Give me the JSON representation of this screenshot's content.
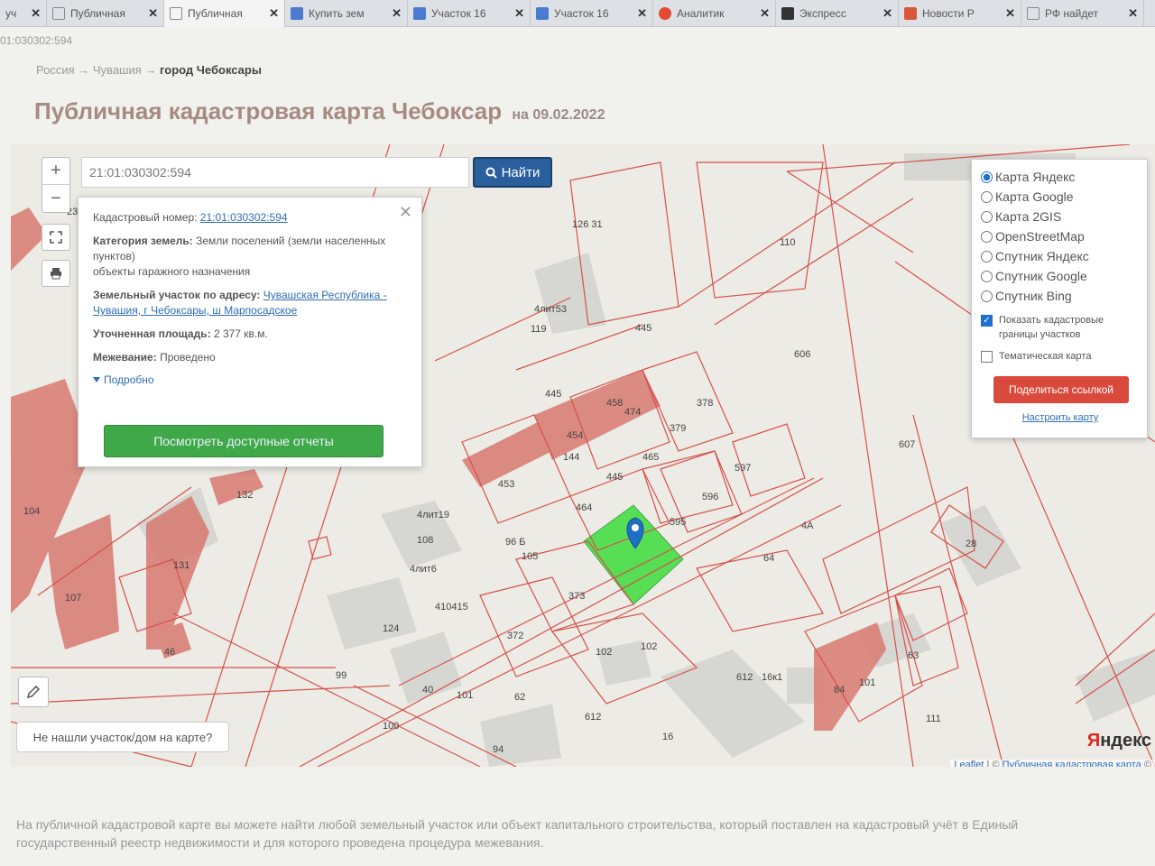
{
  "tabs": [
    {
      "title": "уч",
      "color": "#999999"
    },
    {
      "title": "Публичная",
      "color": "#8a8a8a"
    },
    {
      "title": "Публичная",
      "color": "#8a8a8a"
    },
    {
      "title": "Купить зем",
      "color": "#4a7bd1"
    },
    {
      "title": "Участок 16",
      "color": "#4a7bd1"
    },
    {
      "title": "Участок 16",
      "color": "#4a7bd1"
    },
    {
      "title": "Аналитик",
      "color": "#e14b32"
    },
    {
      "title": "Экспресс",
      "color": "#333333"
    },
    {
      "title": "Новости Р",
      "color": "#d9573a"
    },
    {
      "title": "РФ найдет",
      "color": "#888888"
    }
  ],
  "url_fragment": "01:030302:594",
  "breadcrumb": {
    "country": "Россия",
    "region": "Чувашия",
    "city": "город Чебоксары",
    "separator": "→"
  },
  "page": {
    "title": "Публичная кадастровая карта Чебоксар",
    "date": "на 09.02.2022"
  },
  "search": {
    "value": "21:01:030302:594",
    "button_label": "Найти"
  },
  "info_popup": {
    "cadastral_label": "Кадастровый номер:",
    "cadastral_number": "21:01:030302:594",
    "category_label": "Категория земель:",
    "category_value": "Земли поселений (земли населенных пунктов)",
    "category_use": "объекты гаражного назначения",
    "address_label": "Земельный участок по адресу:",
    "address_value": "Чувашская Республика - Чувашия, г Чебоксары, ш Марпосадское",
    "area_label": "Уточненная площадь:",
    "area_value": "2 377 кв.м.",
    "survey_label": "Межевание:",
    "survey_value": "Проведено",
    "more_link": "Подробно",
    "reports_button": "Посмотреть доступные отчеты"
  },
  "layers": {
    "options": [
      "Карта Яндекс",
      "Карта Google",
      "Карта 2GIS",
      "OpenStreetMap",
      "Спутник Яндекс",
      "Спутник Google",
      "Спутник Bing"
    ],
    "selected": 0,
    "show_boundaries": "Показать кадастровые границы участков",
    "thematic_map": "Тематическая карта",
    "share_button": "Поделиться ссылкой",
    "setup_link": "Настроить карту"
  },
  "map_labels": [
    "126 31",
    "110",
    "445",
    "606",
    "119",
    "4лит53",
    "445",
    "458",
    "474",
    "378",
    "379",
    "454",
    "144",
    "465",
    "597",
    "453",
    "607",
    "445",
    "596",
    "464",
    "595",
    "4лит19",
    "108",
    "96 Б",
    "105",
    "4лит6",
    "4А",
    "28",
    "64",
    "373",
    "410415",
    "372",
    "102",
    "102",
    "612",
    "16к1",
    "63",
    "84",
    "101",
    "99",
    "40",
    "101",
    "62",
    "612",
    "100",
    "94",
    "16",
    "111",
    "132",
    "104",
    "131",
    "107",
    "46",
    "124",
    "23"
  ],
  "not_found_button": "Не нашли участок/дом на карте?",
  "attribution": {
    "leaflet": "Leaflet",
    "separator": "| ©",
    "source": "Публичная кадастровая карта",
    "tail": "©"
  },
  "yandex_logo": {
    "first": "Я",
    "rest": "ндекс"
  },
  "footer_text": "На публичной кадастровой карте вы можете найти любой земельный участок или объект капитального строительства, который поставлен на кадастровый учёт в Единый государственный реестр недвижимости и для которого проведена процедура межевания.",
  "colors": {
    "parcel_line": "#d8504a",
    "building": "#d87a70",
    "selected_parcel": "#3cdc3c",
    "marker": "#1f6fc4",
    "button_blue": "#2a5f9c",
    "button_green": "#3fa94a",
    "button_red": "#d94a3d"
  }
}
